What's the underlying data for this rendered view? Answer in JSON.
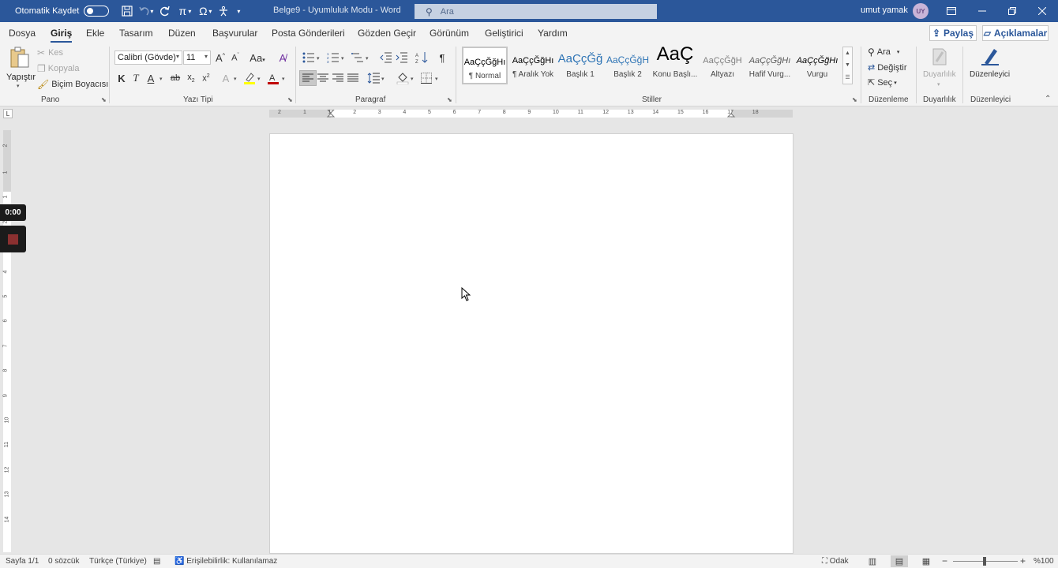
{
  "titlebar": {
    "autosave_label": "Otomatik Kaydet",
    "doc_title": "Belge9  -  Uyumluluk Modu  -  Word",
    "search_placeholder": "Ara",
    "user_name": "umut yamak",
    "user_initials": "UY"
  },
  "tabs": [
    "Dosya",
    "Giriş",
    "Ekle",
    "Tasarım",
    "Düzen",
    "Başvurular",
    "Posta Gönderileri",
    "Gözden Geçir",
    "Görünüm",
    "Geliştirici",
    "Yardım"
  ],
  "active_tab": "Giriş",
  "share": {
    "label": "Paylaş",
    "comments_label": "Açıklamalar"
  },
  "ribbon": {
    "clipboard": {
      "paste": "Yapıştır",
      "cut": "Kes",
      "copy": "Kopyala",
      "format_painter": "Biçim Boyacısı",
      "group_label": "Pano"
    },
    "font": {
      "font_name": "Calibri (Gövde)",
      "font_size": "11",
      "bold": "K",
      "italic": "T",
      "underline": "A",
      "group_label": "Yazı Tipi"
    },
    "paragraph": {
      "group_label": "Paragraf"
    },
    "styles": {
      "items": [
        {
          "preview": "AaÇçĞğHı",
          "name": "¶ Normal"
        },
        {
          "preview": "AaÇçĞğHı",
          "name": "¶ Aralık Yok"
        },
        {
          "preview": "AaÇçĞğ",
          "name": "Başlık 1"
        },
        {
          "preview": "AaÇçĞğH",
          "name": "Başlık 2"
        },
        {
          "preview": "AaÇ",
          "name": "Konu Başlı..."
        },
        {
          "preview": "AaÇçĞğH",
          "name": "Altyazı"
        },
        {
          "preview": "AaÇçĞğHı",
          "name": "Hafif Vurg..."
        },
        {
          "preview": "AaÇçĞğHı",
          "name": "Vurgu"
        }
      ],
      "group_label": "Stiller"
    },
    "editing": {
      "find": "Ara",
      "replace": "Değiştir",
      "select": "Seç",
      "group_label": "Düzenleme"
    },
    "sensitivity": {
      "label": "Duyarlılık",
      "group_label": "Duyarlılık"
    },
    "editor": {
      "label": "Düzenleyici",
      "group_label": "Düzenleyici"
    }
  },
  "ruler": {
    "h_numbers": [
      "2",
      "1",
      "1",
      "2",
      "3",
      "4",
      "5",
      "6",
      "7",
      "8",
      "9",
      "10",
      "11",
      "12",
      "13",
      "14",
      "15",
      "16",
      "17",
      "18"
    ],
    "v_numbers": [
      "2",
      "1",
      "1",
      "2",
      "3",
      "4",
      "5",
      "6",
      "7",
      "8",
      "9",
      "10",
      "11",
      "12",
      "13",
      "14"
    ]
  },
  "recorder": {
    "time": "0:00"
  },
  "statusbar": {
    "page": "Sayfa 1/1",
    "words": "0 sözcük",
    "language": "Türkçe (Türkiye)",
    "accessibility": "Erişilebilirlik: Kullanılamaz",
    "focus": "Odak",
    "zoom": "%100"
  },
  "colors": {
    "title_bar": "#2b579a",
    "highlight": "#ffff00",
    "font_color": "#c00000",
    "recorder_stop": "#8b3030"
  }
}
